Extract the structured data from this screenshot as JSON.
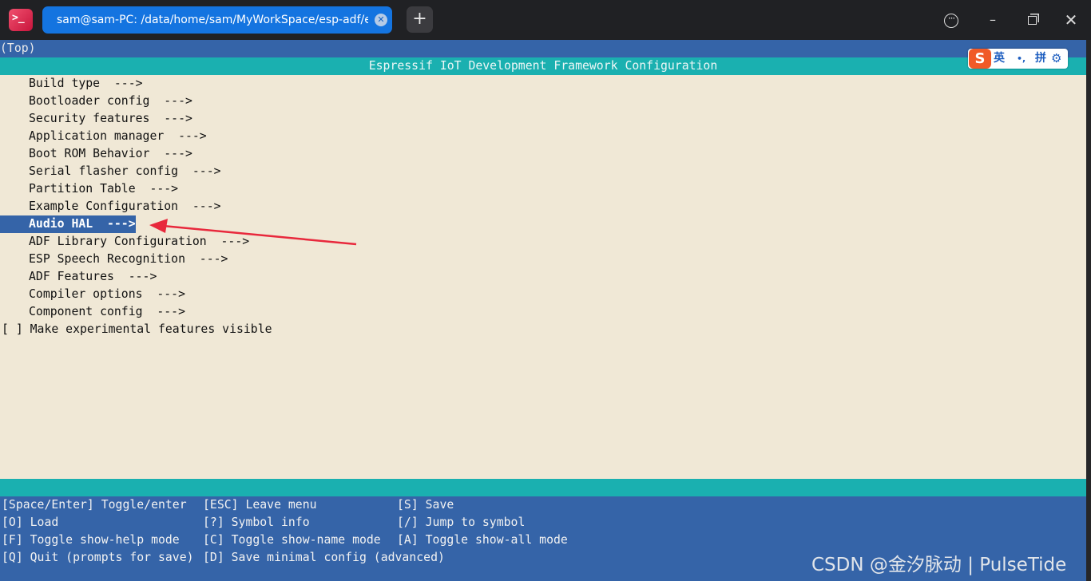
{
  "titlebar": {
    "app_icon_glyph": ">_",
    "tab_title": "sam@sam-PC: /data/home/sam/MyWorkSpace/esp-adf/exa···",
    "tab_close_glyph": "✕",
    "new_tab_glyph": "+",
    "more_glyph": "···",
    "minimize_glyph": "–",
    "close_glyph": "✕"
  },
  "terminal": {
    "top_text": "(Top)",
    "header_text": "Espressif IoT Development Framework Configuration",
    "menu_items": [
      "Build type  --->",
      "Bootloader config  --->",
      "Security features  --->",
      "Application manager  --->",
      "Boot ROM Behavior  --->",
      "Serial flasher config  --->",
      "Partition Table  --->",
      "Example Configuration  --->",
      "Audio HAL  --->",
      "ADF Library Configuration  --->",
      "ESP Speech Recognition  --->",
      "ADF Features  --->",
      "Compiler options  --->",
      "Component config  --->"
    ],
    "selected_item": "Audio HAL  --->",
    "checkbox_item": "[ ] Make experimental features visible",
    "help_rows": [
      [
        "[Space/Enter] Toggle/enter",
        "[ESC] Leave menu",
        "[S] Save"
      ],
      [
        "[O] Load",
        "[?] Symbol info",
        "[/] Jump to symbol"
      ],
      [
        "[F] Toggle show-help mode",
        "[C] Toggle show-name mode",
        "[A] Toggle show-all mode"
      ],
      [
        "[Q] Quit (prompts for save)",
        "[D] Save minimal config (advanced)",
        ""
      ]
    ]
  },
  "ime": {
    "logo": "S",
    "lang": "英",
    "punct": "•,",
    "mode": "拼",
    "settings_glyph": "⚙"
  },
  "watermark": "CSDN @金汐脉动 | PulseTide",
  "colors": {
    "terminal_bg": "#f0e8d6",
    "header_teal": "#1ab0b0",
    "selection_blue": "#3564a8",
    "tab_blue": "#1474e0",
    "annotation_arrow": "#e8283c"
  }
}
